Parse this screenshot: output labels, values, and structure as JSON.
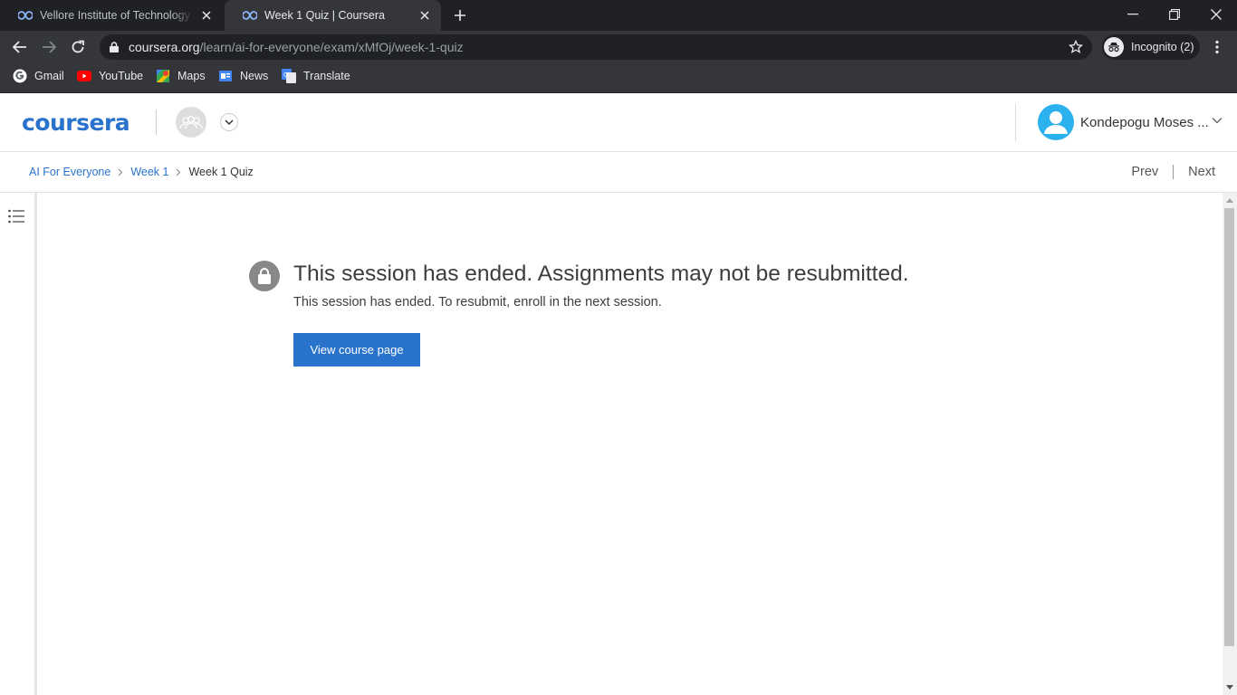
{
  "browser": {
    "tabs": [
      {
        "title": "Vellore Institute of Technology | C",
        "active": false
      },
      {
        "title": "Week 1 Quiz | Coursera",
        "active": true
      }
    ],
    "url_host": "coursera.org",
    "url_path": "/learn/ai-for-everyone/exam/xMfOj/week-1-quiz",
    "incognito_label": "Incognito (2)",
    "bookmarks": [
      "Gmail",
      "YouTube",
      "Maps",
      "News",
      "Translate"
    ]
  },
  "header": {
    "logo_text": "coursera",
    "user_name": "Kondepogu Moses ..."
  },
  "breadcrumb": {
    "items": [
      "AI For Everyone",
      "Week 1",
      "Week 1 Quiz"
    ],
    "prev_label": "Prev",
    "next_label": "Next"
  },
  "main": {
    "headline": "This session has ended. Assignments may not be resubmitted.",
    "subline": "This session has ended. To resubmit, enroll in the next session.",
    "button_label": "View course page"
  },
  "colors": {
    "brand": "#2a73cc",
    "avatar": "#2bb1ed",
    "chrome_dark": "#202124",
    "chrome_mid": "#35363a"
  }
}
